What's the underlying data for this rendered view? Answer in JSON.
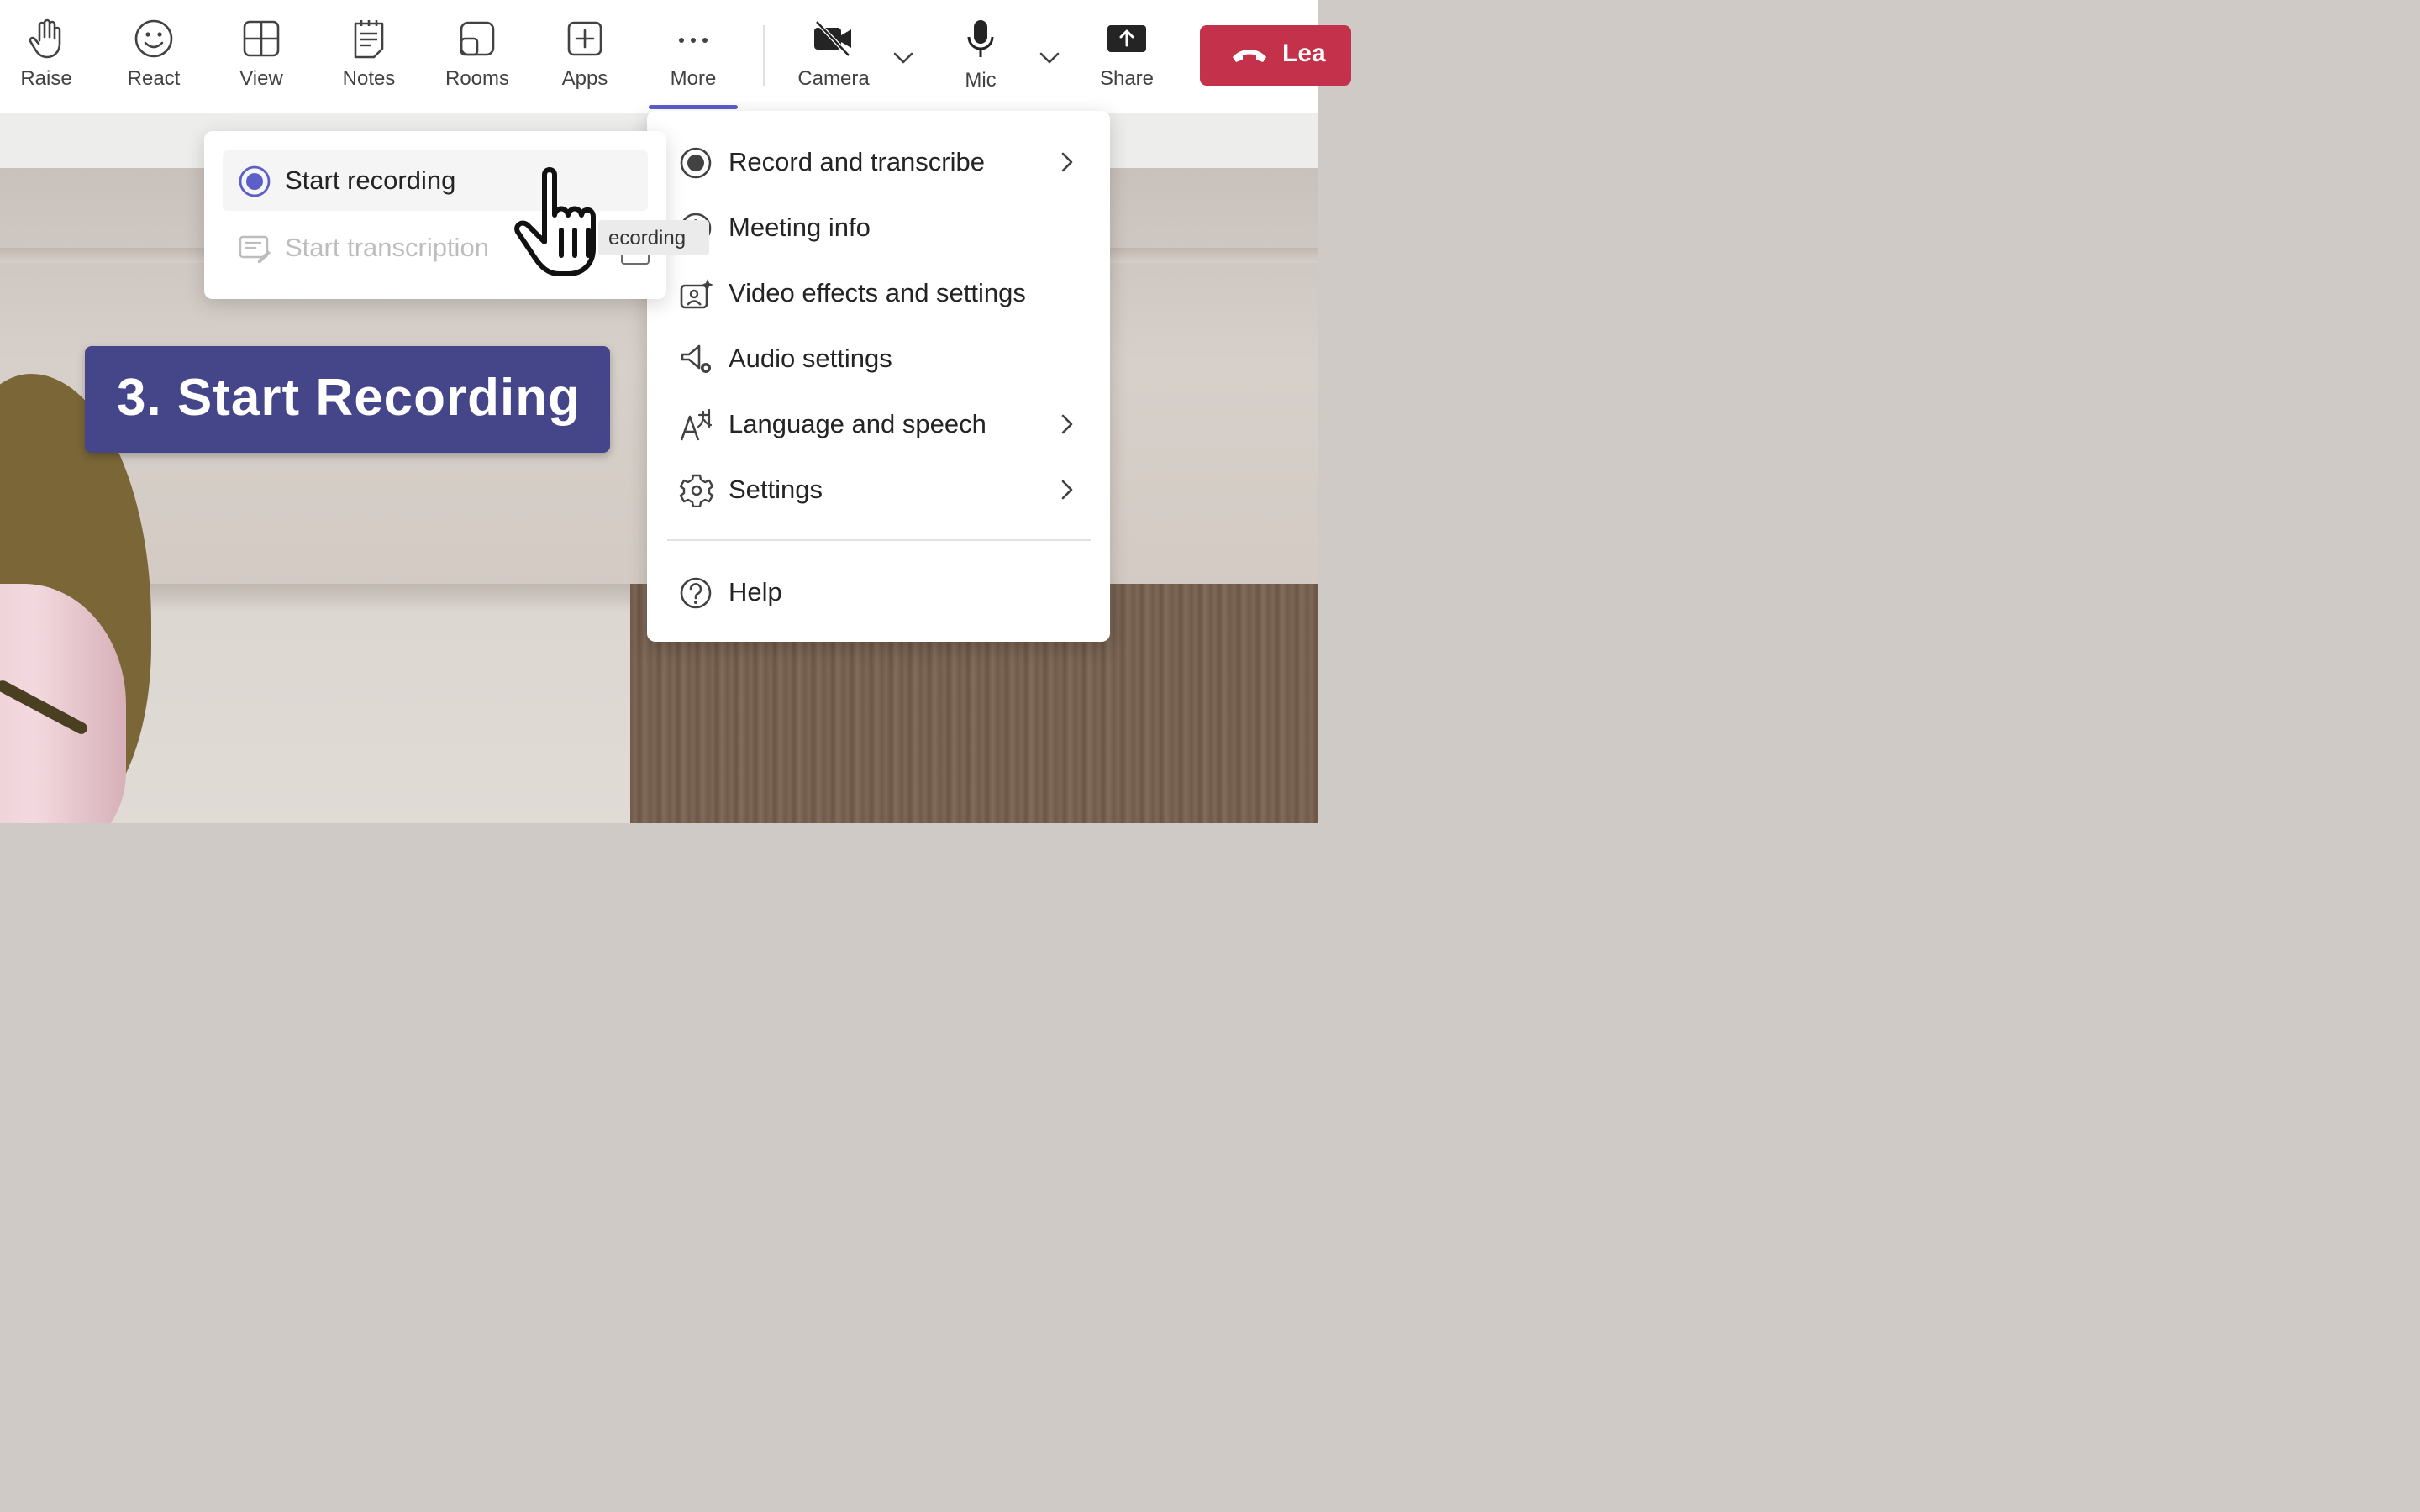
{
  "toolbar": {
    "buttons": [
      {
        "id": "raise",
        "label": "Raise",
        "icon": "hand-icon"
      },
      {
        "id": "react",
        "label": "React",
        "icon": "smiley-icon"
      },
      {
        "id": "view",
        "label": "View",
        "icon": "grid-icon"
      },
      {
        "id": "notes",
        "label": "Notes",
        "icon": "notes-icon"
      },
      {
        "id": "rooms",
        "label": "Rooms",
        "icon": "rooms-icon"
      },
      {
        "id": "apps",
        "label": "Apps",
        "icon": "plus-box-icon"
      },
      {
        "id": "more",
        "label": "More",
        "icon": "ellipsis-icon",
        "active": true
      },
      {
        "id": "camera",
        "label": "Camera",
        "icon": "camera-off-icon"
      },
      {
        "id": "mic",
        "label": "Mic",
        "icon": "mic-icon"
      },
      {
        "id": "share",
        "label": "Share",
        "icon": "share-icon"
      }
    ],
    "leave_label": "Lea",
    "leave_color": "#c4314b",
    "accent_color": "#5b5fc7"
  },
  "more_menu": {
    "items": [
      {
        "label": "Record and transcribe",
        "icon": "record-icon",
        "has_submenu": true
      },
      {
        "label": "Meeting info",
        "icon": "info-icon",
        "has_submenu": false
      },
      {
        "label": "Video effects and settings",
        "icon": "video-effects-icon",
        "has_submenu": false
      },
      {
        "label": "Audio settings",
        "icon": "audio-settings-icon",
        "has_submenu": false
      },
      {
        "label": "Language and speech",
        "icon": "language-icon",
        "has_submenu": true
      },
      {
        "label": "Settings",
        "icon": "gear-icon",
        "has_submenu": true
      }
    ],
    "help_label": "Help"
  },
  "record_submenu": {
    "items": [
      {
        "label": "Start recording",
        "icon": "record-dot-icon",
        "state": "hover"
      },
      {
        "label": "Start transcription",
        "icon": "transcript-icon",
        "state": "disabled"
      }
    ]
  },
  "tooltip": {
    "text": "ecording"
  },
  "callout": {
    "text": "3. Start Recording",
    "color": "#454589"
  }
}
